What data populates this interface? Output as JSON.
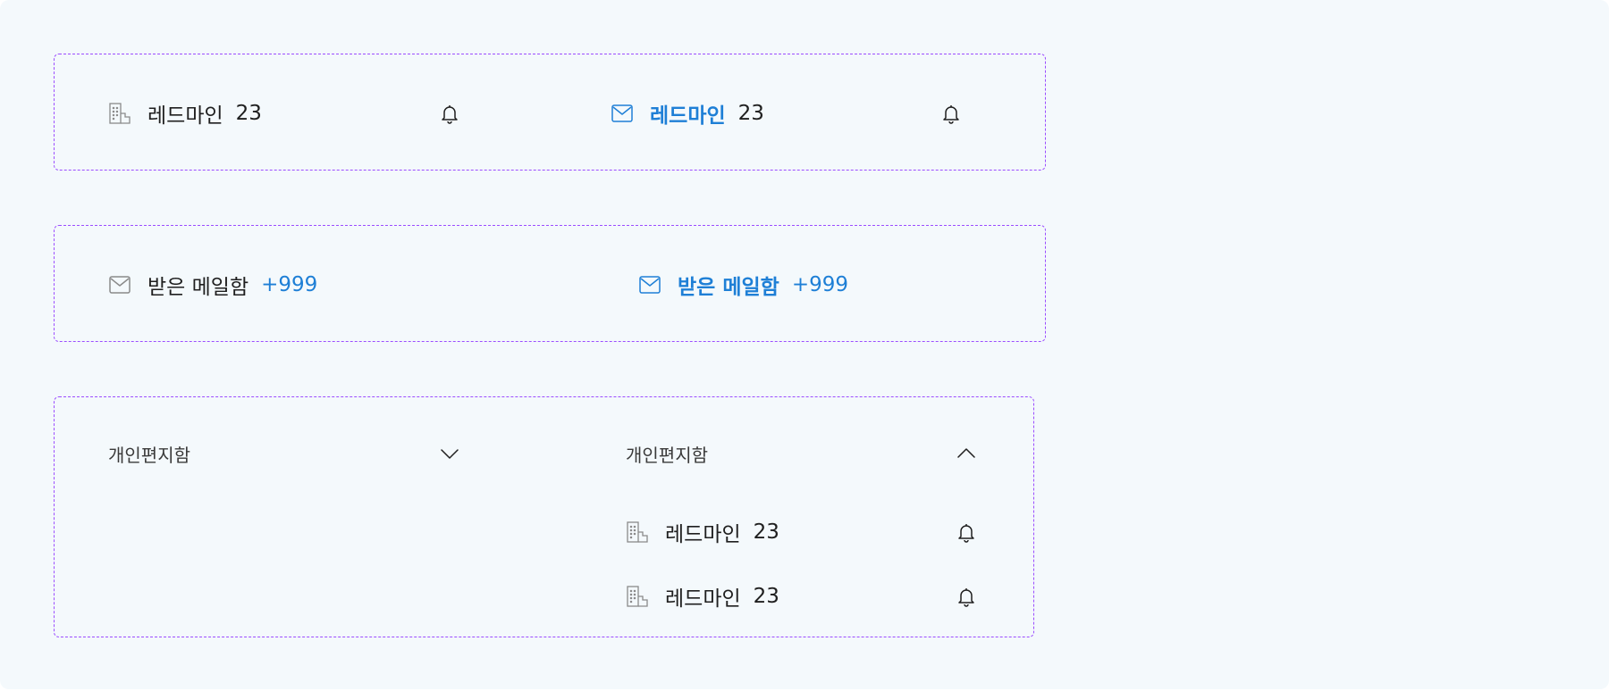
{
  "colors": {
    "background": "#f4f9fc",
    "accent": "#1e7fd6",
    "dashed_border": "#9b4dff",
    "icon_gray": "#8a8a8a",
    "text": "#1f1f1f"
  },
  "group1": {
    "default_item": {
      "label": "레드마인",
      "count": "23",
      "icon": "building-icon",
      "trailing_icon": "bell-icon"
    },
    "active_item": {
      "label": "레드마인",
      "count": "23",
      "icon": "mail-icon",
      "trailing_icon": "bell-icon"
    }
  },
  "group2": {
    "default_item": {
      "label": "받은 메일함",
      "count": "+999",
      "icon": "mail-icon"
    },
    "active_item": {
      "label": "받은 메일함",
      "count": "+999",
      "icon": "mail-icon"
    }
  },
  "group3": {
    "collapsed_folder": {
      "label": "개인편지함",
      "icon": "chevron-down-icon"
    },
    "expanded_folder": {
      "label": "개인편지함",
      "icon": "chevron-up-icon",
      "children": [
        {
          "label": "레드마인",
          "count": "23",
          "icon": "building-icon",
          "trailing_icon": "bell-icon"
        },
        {
          "label": "레드마인",
          "count": "23",
          "icon": "building-icon",
          "trailing_icon": "bell-icon"
        }
      ]
    }
  }
}
